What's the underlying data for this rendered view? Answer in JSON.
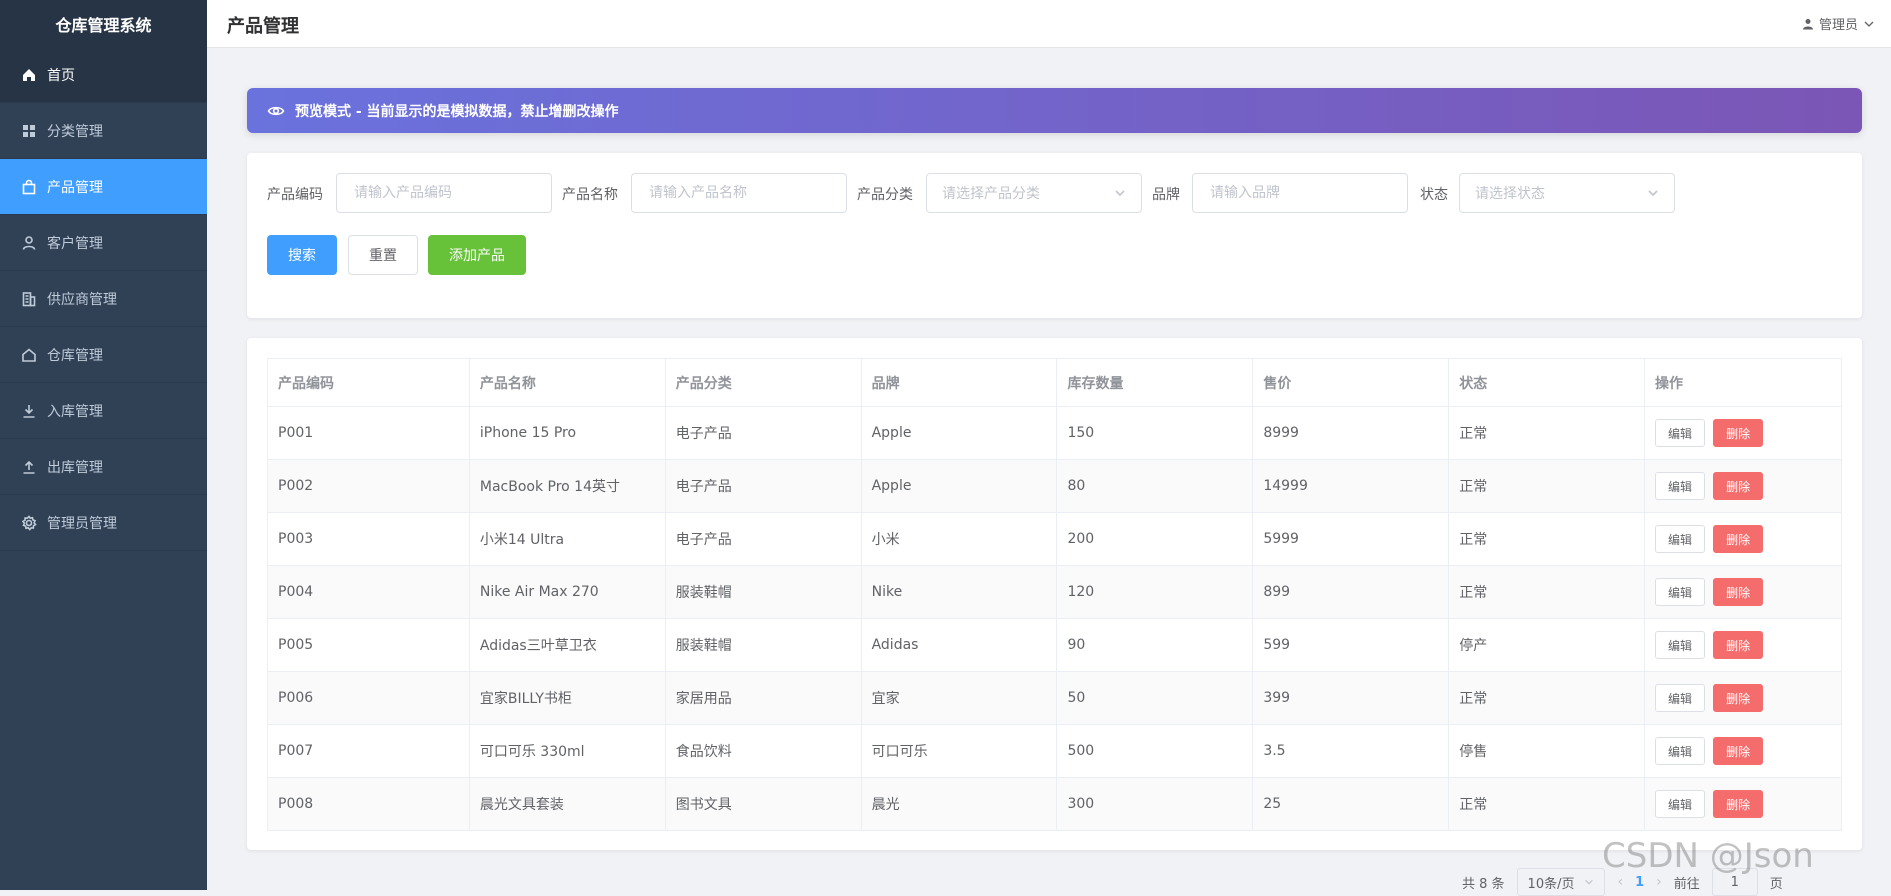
{
  "app": {
    "title": "仓库管理系统"
  },
  "sidebar": {
    "items": [
      {
        "label": "首页",
        "icon": "home-icon"
      },
      {
        "label": "分类管理",
        "icon": "grid-icon"
      },
      {
        "label": "产品管理",
        "icon": "bag-icon"
      },
      {
        "label": "客户管理",
        "icon": "user-icon"
      },
      {
        "label": "供应商管理",
        "icon": "building-icon"
      },
      {
        "label": "仓库管理",
        "icon": "house-icon"
      },
      {
        "label": "入库管理",
        "icon": "download-icon"
      },
      {
        "label": "出库管理",
        "icon": "upload-icon"
      },
      {
        "label": "管理员管理",
        "icon": "gear-icon"
      }
    ]
  },
  "header": {
    "title": "产品管理",
    "user": "管理员"
  },
  "banner": {
    "text": "预览模式 - 当前显示的是模拟数据，禁止增删改操作"
  },
  "search": {
    "code_label": "产品编码",
    "code_placeholder": "请输入产品编码",
    "name_label": "产品名称",
    "name_placeholder": "请输入产品名称",
    "category_label": "产品分类",
    "category_placeholder": "请选择产品分类",
    "brand_label": "品牌",
    "brand_placeholder": "请输入品牌",
    "status_label": "状态",
    "status_placeholder": "请选择状态",
    "search_button": "搜索",
    "reset_button": "重置",
    "add_button": "添加产品"
  },
  "table": {
    "columns": [
      "产品编码",
      "产品名称",
      "产品分类",
      "品牌",
      "库存数量",
      "售价",
      "状态",
      "操作"
    ],
    "edit_label": "编辑",
    "delete_label": "删除",
    "rows": [
      {
        "code": "P001",
        "name": "iPhone 15 Pro",
        "category": "电子产品",
        "brand": "Apple",
        "stock": "150",
        "price": "8999",
        "status": "正常"
      },
      {
        "code": "P002",
        "name": "MacBook Pro 14英寸",
        "category": "电子产品",
        "brand": "Apple",
        "stock": "80",
        "price": "14999",
        "status": "正常"
      },
      {
        "code": "P003",
        "name": "小米14 Ultra",
        "category": "电子产品",
        "brand": "小米",
        "stock": "200",
        "price": "5999",
        "status": "正常"
      },
      {
        "code": "P004",
        "name": "Nike Air Max 270",
        "category": "服装鞋帽",
        "brand": "Nike",
        "stock": "120",
        "price": "899",
        "status": "正常"
      },
      {
        "code": "P005",
        "name": "Adidas三叶草卫衣",
        "category": "服装鞋帽",
        "brand": "Adidas",
        "stock": "90",
        "price": "599",
        "status": "停产"
      },
      {
        "code": "P006",
        "name": "宜家BILLY书柜",
        "category": "家居用品",
        "brand": "宜家",
        "stock": "50",
        "price": "399",
        "status": "正常"
      },
      {
        "code": "P007",
        "name": "可口可乐 330ml",
        "category": "食品饮料",
        "brand": "可口可乐",
        "stock": "500",
        "price": "3.5",
        "status": "停售"
      },
      {
        "code": "P008",
        "name": "晨光文具套装",
        "category": "图书文具",
        "brand": "晨光",
        "stock": "300",
        "price": "25",
        "status": "正常"
      }
    ]
  },
  "pagination": {
    "total": "共 8 条",
    "page_size": "10条/页",
    "current_page": "1",
    "goto_label": "前往",
    "goto_value": "1",
    "page_suffix": "页"
  },
  "watermark": "CSDN @Json"
}
